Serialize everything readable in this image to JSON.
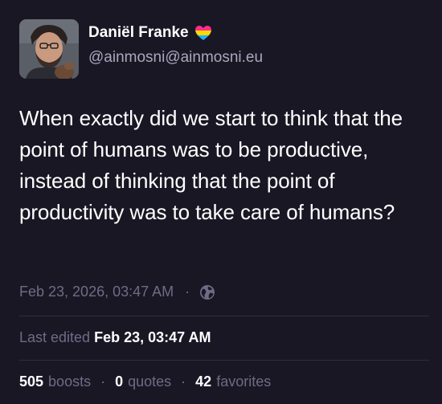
{
  "author": {
    "display_name": "Daniël Franke",
    "handle": "@ainmosni@ainmosni.eu",
    "badge_icon": "pansexual-heart-icon"
  },
  "post": {
    "content": "When exactly did we start to think that the point of humans was to be productive, instead of thinking that the point of productivity was to take care of humans?",
    "timestamp": "Feb 23, 2026, 03:47 AM",
    "separator": "·",
    "visibility_icon": "globe-icon",
    "edited_label": "Last edited",
    "edited_date": "Feb 23, 03:47 AM"
  },
  "stats": {
    "boosts_count": "505",
    "boosts_label": "boosts",
    "quotes_count": "0",
    "quotes_label": "quotes",
    "favorites_count": "42",
    "favorites_label": "favorites",
    "separator": "·"
  },
  "colors": {
    "background": "#191724",
    "muted_text": "#6e6c85",
    "handle_text": "#a9a8bd",
    "heart_top": "#ff2d8a",
    "heart_middle": "#ffd800",
    "heart_bottom": "#21b1ff"
  }
}
